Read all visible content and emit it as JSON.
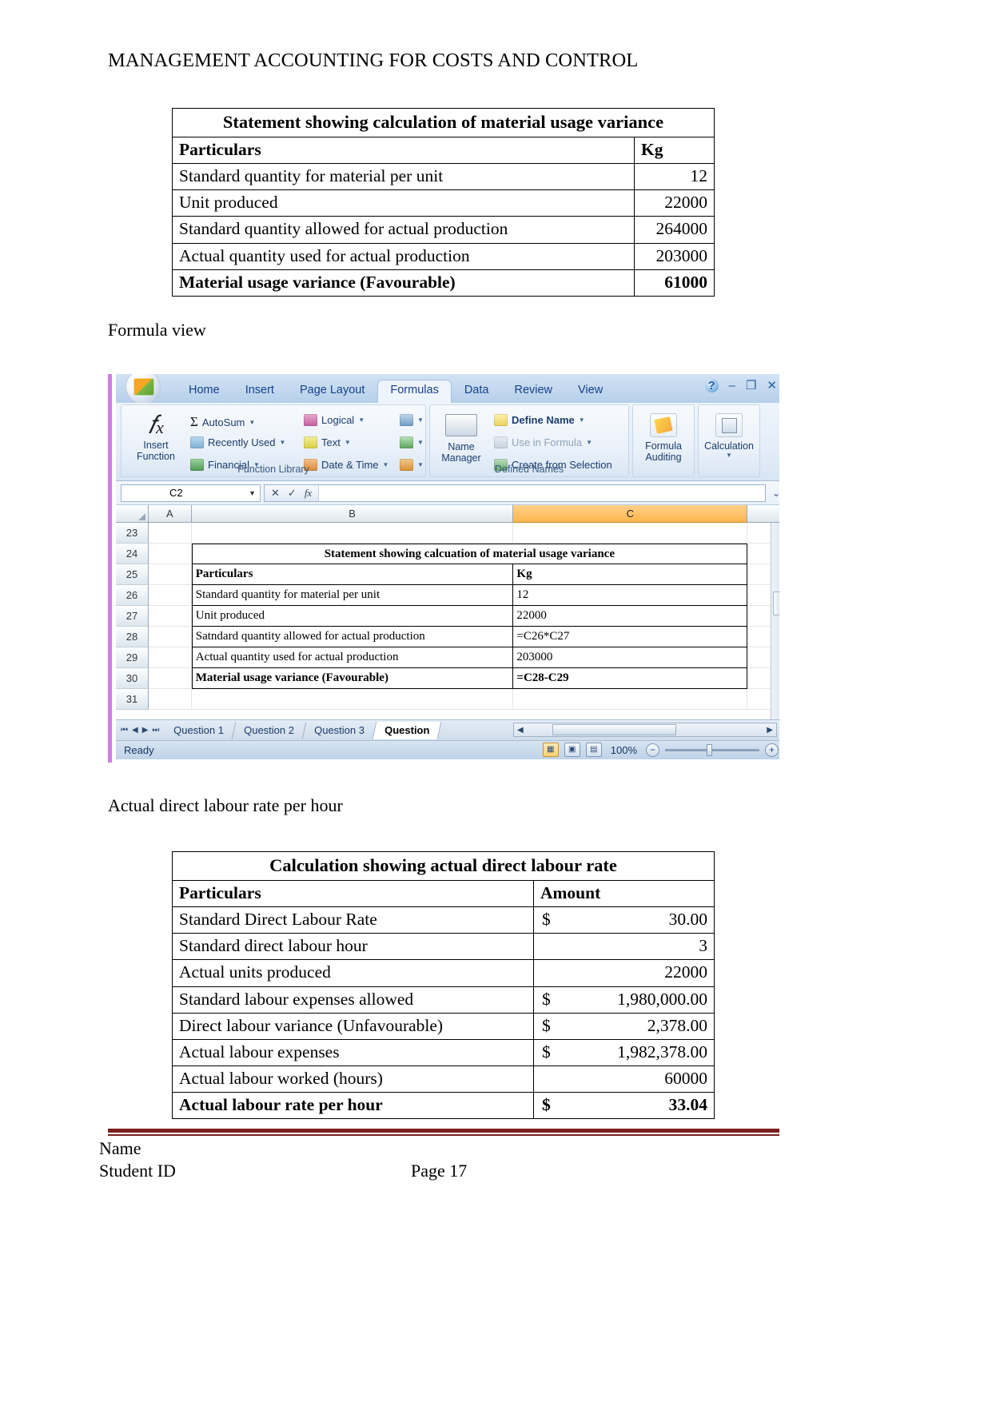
{
  "document": {
    "header": "MANAGEMENT ACCOUNTING FOR COSTS AND CONTROL",
    "caption_formula_view": "Formula view",
    "caption_actual_rate": "Actual direct labour rate per hour"
  },
  "table_usage": {
    "title": "Statement showing calculation of material usage variance",
    "columns": [
      "Particulars",
      "Kg"
    ],
    "rows": [
      {
        "label": "Standard quantity for material per unit",
        "value": "12"
      },
      {
        "label": "Unit produced",
        "value": "22000"
      },
      {
        "label": "Standard quantity allowed for actual production",
        "value": "264000"
      },
      {
        "label": "Actual quantity used for actual production",
        "value": "203000"
      },
      {
        "label": "Material usage variance (Favourable)",
        "value": "61000"
      }
    ]
  },
  "table_labour": {
    "title": "Calculation showing actual direct labour rate",
    "columns": [
      "Particulars",
      "Amount"
    ],
    "rows": [
      {
        "label": "Standard Direct Labour Rate",
        "symbol": "$",
        "value": "30.00"
      },
      {
        "label": "Standard direct labour hour",
        "symbol": "",
        "value": "3"
      },
      {
        "label": "Actual units produced",
        "symbol": "",
        "value": "22000"
      },
      {
        "label": "Standard labour expenses allowed",
        "symbol": "$",
        "value": "1,980,000.00"
      },
      {
        "label": "Direct labour variance (Unfavourable)",
        "symbol": "$",
        "value": "2,378.00"
      },
      {
        "label": "Actual labour expenses",
        "symbol": "$",
        "value": "1,982,378.00"
      },
      {
        "label": "Actual labour worked (hours)",
        "symbol": "",
        "value": "60000"
      },
      {
        "label": "Actual labour rate per hour",
        "symbol": "$",
        "value": "33.04"
      }
    ]
  },
  "excel": {
    "ribbon_tabs": [
      {
        "label": "Home",
        "active": false
      },
      {
        "label": "Insert",
        "active": false
      },
      {
        "label": "Page Layout",
        "active": false
      },
      {
        "label": "Formulas",
        "active": true
      },
      {
        "label": "Data",
        "active": false
      },
      {
        "label": "Review",
        "active": false
      },
      {
        "label": "View",
        "active": false
      }
    ],
    "window_controls": {
      "help": "?",
      "minimize": "–",
      "restore": "❐",
      "close": "✕"
    },
    "groups": {
      "function_library": {
        "label": "Function Library",
        "insert_function": "Insert\nFunction",
        "insert_function_line1": "Insert",
        "insert_function_line2": "Function",
        "items": [
          "AutoSum",
          "Recently Used",
          "Financial",
          "Logical",
          "Text",
          "Date & Time"
        ]
      },
      "defined_names": {
        "label": "Defined Names",
        "name_manager_line1": "Name",
        "name_manager_line2": "Manager",
        "items": [
          "Define Name",
          "Use in Formula",
          "Create from Selection"
        ]
      },
      "formula_auditing": {
        "label_line1": "Formula",
        "label_line2": "Auditing"
      },
      "calculation": {
        "label": "Calculation"
      }
    },
    "formula_bar": {
      "name_box": "C2",
      "formula_value": ""
    },
    "column_headers": [
      "A",
      "B",
      "C"
    ],
    "rows": [
      {
        "num": "23",
        "b": "",
        "c": "",
        "kind": "empty"
      },
      {
        "num": "24",
        "b": "Statement showing calcuation of material usage variance",
        "c": "",
        "kind": "title"
      },
      {
        "num": "25",
        "b": "Particulars",
        "c": "Kg",
        "kind": "header"
      },
      {
        "num": "26",
        "b": "Standard quantity for material per unit",
        "c": "12",
        "kind": "data"
      },
      {
        "num": "27",
        "b": "Unit produced",
        "c": "22000",
        "kind": "data"
      },
      {
        "num": "28",
        "b": "Satndard quantity allowed for actual production",
        "c": "=C26*C27",
        "kind": "data"
      },
      {
        "num": "29",
        "b": "Actual quantity used for actual production",
        "c": "203000",
        "kind": "data"
      },
      {
        "num": "30",
        "b": "Material usage variance (Favourable)",
        "c": "=C28-C29",
        "kind": "total"
      },
      {
        "num": "31",
        "b": "",
        "c": "",
        "kind": "empty"
      }
    ],
    "sheet_tabs": [
      {
        "label": "Question 1",
        "active": false
      },
      {
        "label": "Question 2",
        "active": false
      },
      {
        "label": "Question 3",
        "active": false
      },
      {
        "label": "Question",
        "active": true
      }
    ],
    "status": {
      "text": "Ready",
      "zoom": "100%"
    }
  },
  "footer": {
    "name": "Name",
    "student_id": "Student ID",
    "page": "Page 17"
  },
  "colors": {
    "selected_column": "#ffb64d",
    "ribbon_blue": "#15428b",
    "footer_rule": "#7b1f1f",
    "left_edge_purple": "#cf7fe0"
  }
}
